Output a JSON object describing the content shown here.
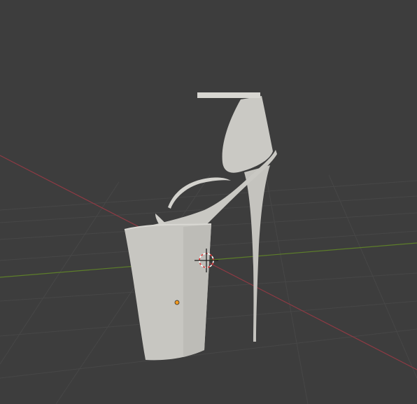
{
  "viewport": {
    "background_color": "#3d3d3d",
    "grid_color": "#474747",
    "x_axis_color": "#8f3a44",
    "y_axis_color": "#5d7e2a",
    "model_color": "#c7c6c1",
    "origin_color": "#f29a21",
    "cursor_colors": [
      "#e33a3a",
      "#ffffff"
    ]
  },
  "scene": {
    "object": "platform-high-heel-sandal",
    "object_selected": false,
    "has_3d_cursor": true,
    "has_object_origin": true
  }
}
